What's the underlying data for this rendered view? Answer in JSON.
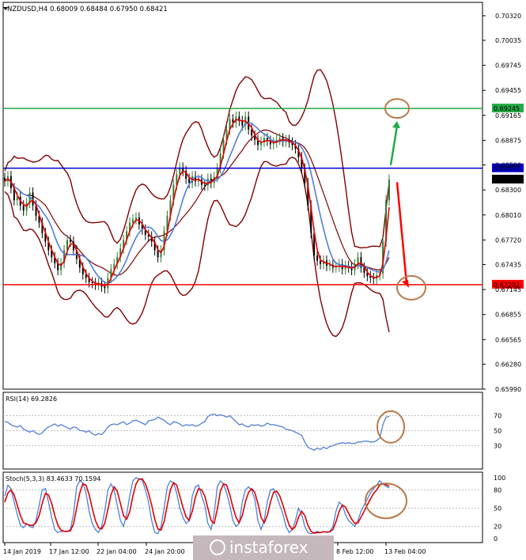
{
  "chart_data": {
    "type": "candlestick",
    "title": "NZDUSD,H4  0.68009 0.68484 0.67950 0.68421",
    "colors": {
      "bull": "#2e7d32",
      "bear": "#000000",
      "ma_fast": "#e00000",
      "ma_slow": "#4f7fd6",
      "bands": "#800000",
      "support": "#ff0000",
      "resistance_blue": "#0000cc",
      "target_green": "#22aa44",
      "circle": "#b77a4a",
      "watermark_bg": "#c5b8bc",
      "oscillator_line": "#4f7fd6"
    },
    "price_axis": {
      "ylim": [
        0.6599,
        0.70475
      ],
      "ticks": [
        "0.70320",
        "0.70035",
        "0.69745",
        "0.69455",
        "0.69165",
        "0.68875",
        "0.68590",
        "0.68300",
        "0.68010",
        "0.67720",
        "0.67435",
        "0.67145",
        "0.66855",
        "0.66565",
        "0.66280",
        "0.65990"
      ]
    },
    "levels": [
      {
        "name": "target",
        "value": 0.69245,
        "label": "0.69245",
        "color": "#22aa44"
      },
      {
        "name": "resistance",
        "value": 0.68552,
        "label": "0.68552",
        "color": "#0000cc"
      },
      {
        "name": "current",
        "value": 0.68421,
        "label": "0.68421",
        "color": "#000000"
      },
      {
        "name": "support",
        "value": 0.67202,
        "label": "0.67202",
        "color": "#ff0000"
      }
    ],
    "closes": [
      0.684,
      0.6846,
      0.6832,
      0.6818,
      0.6822,
      0.6812,
      0.6806,
      0.6815,
      0.6827,
      0.6812,
      0.68,
      0.6792,
      0.678,
      0.677,
      0.676,
      0.6752,
      0.6745,
      0.6737,
      0.6745,
      0.676,
      0.6772,
      0.677,
      0.676,
      0.675,
      0.674,
      0.6732,
      0.6728,
      0.6723,
      0.6722,
      0.672,
      0.6722,
      0.6718,
      0.6716,
      0.6728,
      0.6738,
      0.6744,
      0.6752,
      0.6762,
      0.6772,
      0.6782,
      0.6792,
      0.6796,
      0.6798,
      0.679,
      0.6784,
      0.6778,
      0.6776,
      0.677,
      0.676,
      0.6752,
      0.676,
      0.6782,
      0.68,
      0.6818,
      0.6836,
      0.6848,
      0.6856,
      0.6852,
      0.6843,
      0.6838,
      0.6846,
      0.684,
      0.6842,
      0.6836,
      0.6835,
      0.6843,
      0.6838,
      0.6845,
      0.6855,
      0.6872,
      0.6888,
      0.69,
      0.6912,
      0.6908,
      0.6915,
      0.691,
      0.6905,
      0.6915,
      0.69,
      0.6893,
      0.6888,
      0.6882,
      0.6886,
      0.689,
      0.6887,
      0.6883,
      0.6885,
      0.6888,
      0.689,
      0.6886,
      0.6888,
      0.6885,
      0.6882,
      0.6878,
      0.6868,
      0.6855,
      0.6838,
      0.6812,
      0.678,
      0.6754,
      0.6748,
      0.6744,
      0.6748,
      0.6742,
      0.6743,
      0.674,
      0.6741,
      0.6744,
      0.6738,
      0.6742,
      0.674,
      0.6737,
      0.6744,
      0.6752,
      0.674,
      0.6734,
      0.673,
      0.6728,
      0.6727,
      0.6731,
      0.6733,
      0.677,
      0.6818,
      0.6842
    ],
    "resistance_candle_index": 0,
    "rsi": {
      "label": "RSI(14) 69.2826",
      "ylim": [
        0,
        100
      ],
      "ticks": [
        "70",
        "50",
        "30"
      ],
      "values": [
        62,
        61,
        58,
        56,
        55,
        57,
        52,
        50,
        48,
        50,
        47,
        45,
        47,
        52,
        55,
        57,
        59,
        56,
        58,
        56,
        54,
        52,
        55,
        54,
        50,
        50,
        48,
        50,
        46,
        44,
        46,
        45,
        49,
        55,
        58,
        59,
        58,
        60,
        62,
        58,
        60,
        63,
        64,
        62,
        60,
        58,
        63,
        64,
        65,
        68,
        66,
        64,
        60,
        58,
        62,
        61,
        59,
        56,
        58,
        57,
        58,
        56,
        57,
        60,
        62,
        69,
        71,
        72,
        70,
        71,
        70,
        68,
        70,
        66,
        62,
        58,
        59,
        56,
        55,
        58,
        57,
        58,
        56,
        57,
        60,
        58,
        58,
        57,
        56,
        55,
        52,
        51,
        50,
        48,
        46,
        44,
        35,
        28,
        26,
        24,
        27,
        25,
        28,
        26,
        29,
        30,
        32,
        33,
        34,
        33,
        34,
        33,
        33,
        35,
        35,
        36,
        36,
        35,
        35,
        37,
        40,
        58,
        68,
        69
      ]
    },
    "stoch": {
      "label": "Stoch(5,3,3) 83.4633 70.1594",
      "ylim": [
        0,
        100
      ],
      "ticks": [
        "100",
        "80",
        "50",
        "20",
        "0"
      ],
      "k": [
        70,
        88,
        82,
        60,
        40,
        22,
        18,
        25,
        20,
        18,
        30,
        55,
        80,
        82,
        60,
        35,
        15,
        10,
        12,
        12,
        12,
        15,
        40,
        85,
        95,
        92,
        75,
        45,
        25,
        15,
        10,
        20,
        45,
        80,
        90,
        80,
        55,
        30,
        20,
        40,
        70,
        95,
        100,
        98,
        96,
        80,
        60,
        30,
        10,
        8,
        20,
        50,
        85,
        95,
        92,
        75,
        50,
        35,
        25,
        30,
        70,
        85,
        88,
        70,
        55,
        25,
        15,
        40,
        85,
        95,
        90,
        75,
        55,
        30,
        20,
        25,
        60,
        80,
        85,
        80,
        65,
        30,
        15,
        30,
        60,
        80,
        82,
        70,
        55,
        40,
        20,
        10,
        15,
        30,
        50,
        40,
        20,
        10,
        8,
        10,
        12,
        10,
        12,
        10,
        12,
        20,
        45,
        60,
        55,
        40,
        30,
        25,
        20,
        30,
        45,
        55,
        65,
        75,
        82,
        88,
        95,
        90,
        86,
        83
      ],
      "d": [
        60,
        75,
        80,
        72,
        55,
        38,
        26,
        24,
        22,
        22,
        26,
        38,
        58,
        74,
        72,
        58,
        38,
        22,
        14,
        12,
        12,
        13,
        24,
        50,
        75,
        90,
        88,
        72,
        50,
        30,
        18,
        16,
        25,
        48,
        72,
        85,
        78,
        58,
        38,
        32,
        44,
        70,
        90,
        98,
        98,
        90,
        75,
        55,
        32,
        16,
        14,
        28,
        55,
        80,
        92,
        88,
        70,
        52,
        36,
        30,
        45,
        68,
        82,
        80,
        70,
        50,
        30,
        25,
        48,
        78,
        90,
        88,
        72,
        52,
        35,
        26,
        38,
        60,
        76,
        82,
        76,
        58,
        35,
        26,
        38,
        60,
        76,
        78,
        70,
        55,
        38,
        22,
        15,
        20,
        35,
        45,
        38,
        22,
        12,
        9,
        10,
        10,
        11,
        11,
        11,
        15,
        28,
        45,
        55,
        52,
        42,
        32,
        25,
        26,
        35,
        45,
        55,
        65,
        74,
        80,
        88,
        90,
        89,
        86
      ]
    },
    "x_labels": [
      "14 Jan 2019",
      "17 Jan 12:00",
      "22 Jan 04:00",
      "24 Jan 20:00",
      "8 Feb 12:00",
      "13 Feb 04:00"
    ],
    "watermark": "instaforex"
  }
}
